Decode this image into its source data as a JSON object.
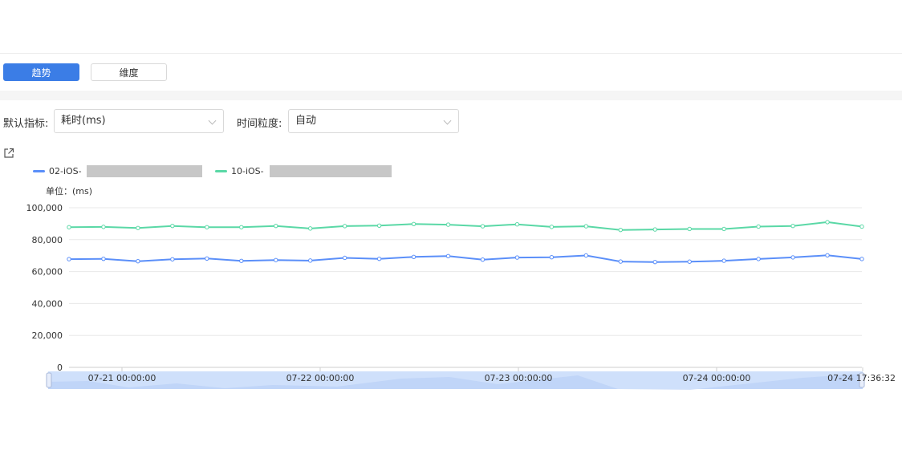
{
  "tabs": {
    "trend": "趋势",
    "dimension": "维度"
  },
  "filters": {
    "metric_label": "默认指标:",
    "metric_value": "耗时(ms)",
    "granularity_label": "时间粒度:",
    "granularity_value": "自动"
  },
  "colors": {
    "accent": "#3b7de6",
    "series_blue": "#5b8ff9",
    "series_green": "#5ad8a6"
  },
  "chart_data": {
    "type": "line",
    "unit_label": "单位：(ms)",
    "y_ticks": [
      "100,000",
      "80,000",
      "60,000",
      "40,000",
      "20,000",
      "0"
    ],
    "ylim": [
      0,
      100000
    ],
    "x_ticks": [
      "07-21 00:00:00",
      "07-22 00:00:00",
      "07-23 00:00:00",
      "07-24 00:00:00",
      "07-24 17:36:32"
    ],
    "series": [
      {
        "name": "02-iOS-",
        "color": "#5b8ff9",
        "values": [
          67800,
          68000,
          66500,
          67700,
          68200,
          66700,
          67200,
          66900,
          68600,
          68000,
          69200,
          69700,
          67500,
          68800,
          69000,
          70100,
          66300,
          66000,
          66200,
          66800,
          67900,
          68900,
          70200,
          67900
        ]
      },
      {
        "name": "10-iOS-",
        "color": "#5ad8a6",
        "values": [
          87800,
          88000,
          87300,
          88600,
          87800,
          87800,
          88600,
          87000,
          88500,
          88800,
          89800,
          89400,
          88400,
          89600,
          88000,
          88400,
          86100,
          86400,
          86700,
          86700,
          88200,
          88600,
          91000,
          88200
        ]
      }
    ],
    "legend_position": "top-left",
    "grid": true
  }
}
